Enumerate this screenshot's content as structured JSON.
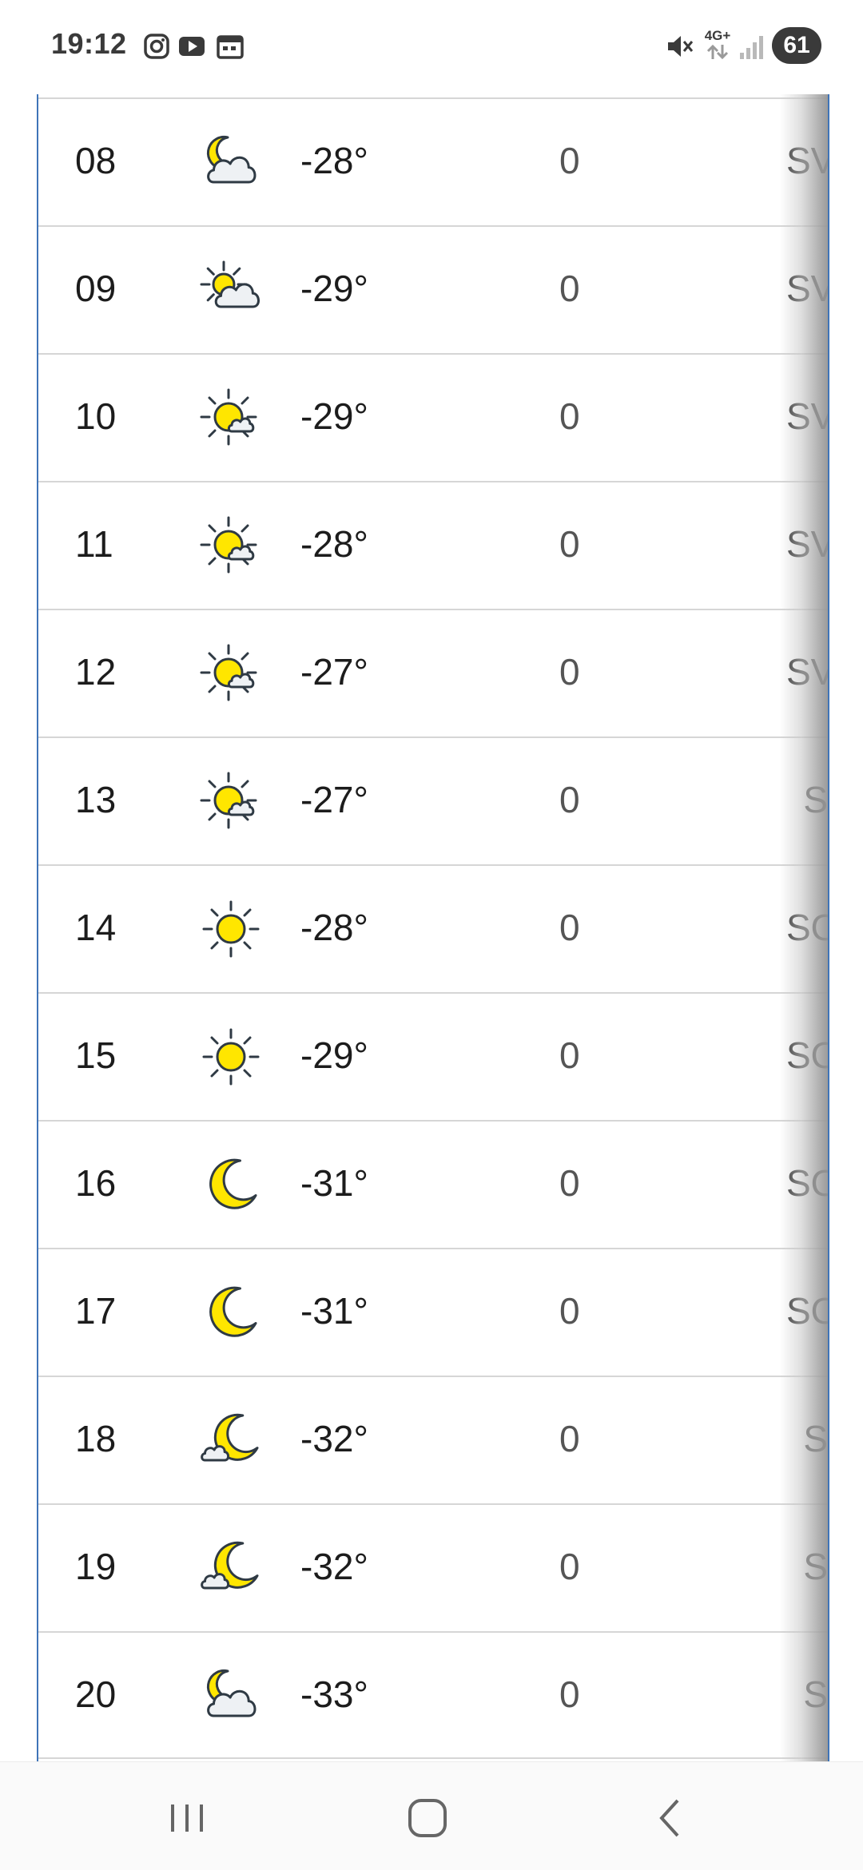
{
  "status_bar": {
    "time": "19:12",
    "left_icons": [
      "instagram-icon",
      "youtube-icon",
      "calendar-icon"
    ],
    "right_icons": [
      "mute-icon",
      "4g-data-icon",
      "signal-icon"
    ],
    "network_label": "4G+",
    "battery": "61"
  },
  "forecast": {
    "rows": [
      {
        "hour": "08",
        "icon": "moon-partly-cloudy-icon",
        "temp": "-28°",
        "precip": "0",
        "wind": "SV"
      },
      {
        "hour": "09",
        "icon": "sun-partly-cloudy-icon",
        "temp": "-29°",
        "precip": "0",
        "wind": "SV"
      },
      {
        "hour": "10",
        "icon": "sun-small-cloud-icon",
        "temp": "-29°",
        "precip": "0",
        "wind": "SV"
      },
      {
        "hour": "11",
        "icon": "sun-small-cloud-icon",
        "temp": "-28°",
        "precip": "0",
        "wind": "SV"
      },
      {
        "hour": "12",
        "icon": "sun-small-cloud-icon",
        "temp": "-27°",
        "precip": "0",
        "wind": "SV"
      },
      {
        "hour": "13",
        "icon": "sun-small-cloud-icon",
        "temp": "-27°",
        "precip": "0",
        "wind": "S"
      },
      {
        "hour": "14",
        "icon": "sun-icon",
        "temp": "-28°",
        "precip": "0",
        "wind": "SO"
      },
      {
        "hour": "15",
        "icon": "sun-icon",
        "temp": "-29°",
        "precip": "0",
        "wind": "SO"
      },
      {
        "hour": "16",
        "icon": "moon-icon",
        "temp": "-31°",
        "precip": "0",
        "wind": "SO"
      },
      {
        "hour": "17",
        "icon": "moon-icon",
        "temp": "-31°",
        "precip": "0",
        "wind": "SO"
      },
      {
        "hour": "18",
        "icon": "moon-small-cloud-icon",
        "temp": "-32°",
        "precip": "0",
        "wind": "S"
      },
      {
        "hour": "19",
        "icon": "moon-small-cloud-icon",
        "temp": "-32°",
        "precip": "0",
        "wind": "S"
      },
      {
        "hour": "20",
        "icon": "moon-partly-cloudy-icon",
        "temp": "-33°",
        "precip": "0",
        "wind": "S"
      }
    ]
  },
  "nav_bar": {
    "buttons": [
      "recent-apps-icon",
      "home-icon",
      "back-icon"
    ]
  },
  "colors": {
    "sun_yellow": "#ffe600",
    "icon_outline": "#2f3a44",
    "cloud_fill": "#eef1f4",
    "frame_blue": "#3f74b8"
  }
}
